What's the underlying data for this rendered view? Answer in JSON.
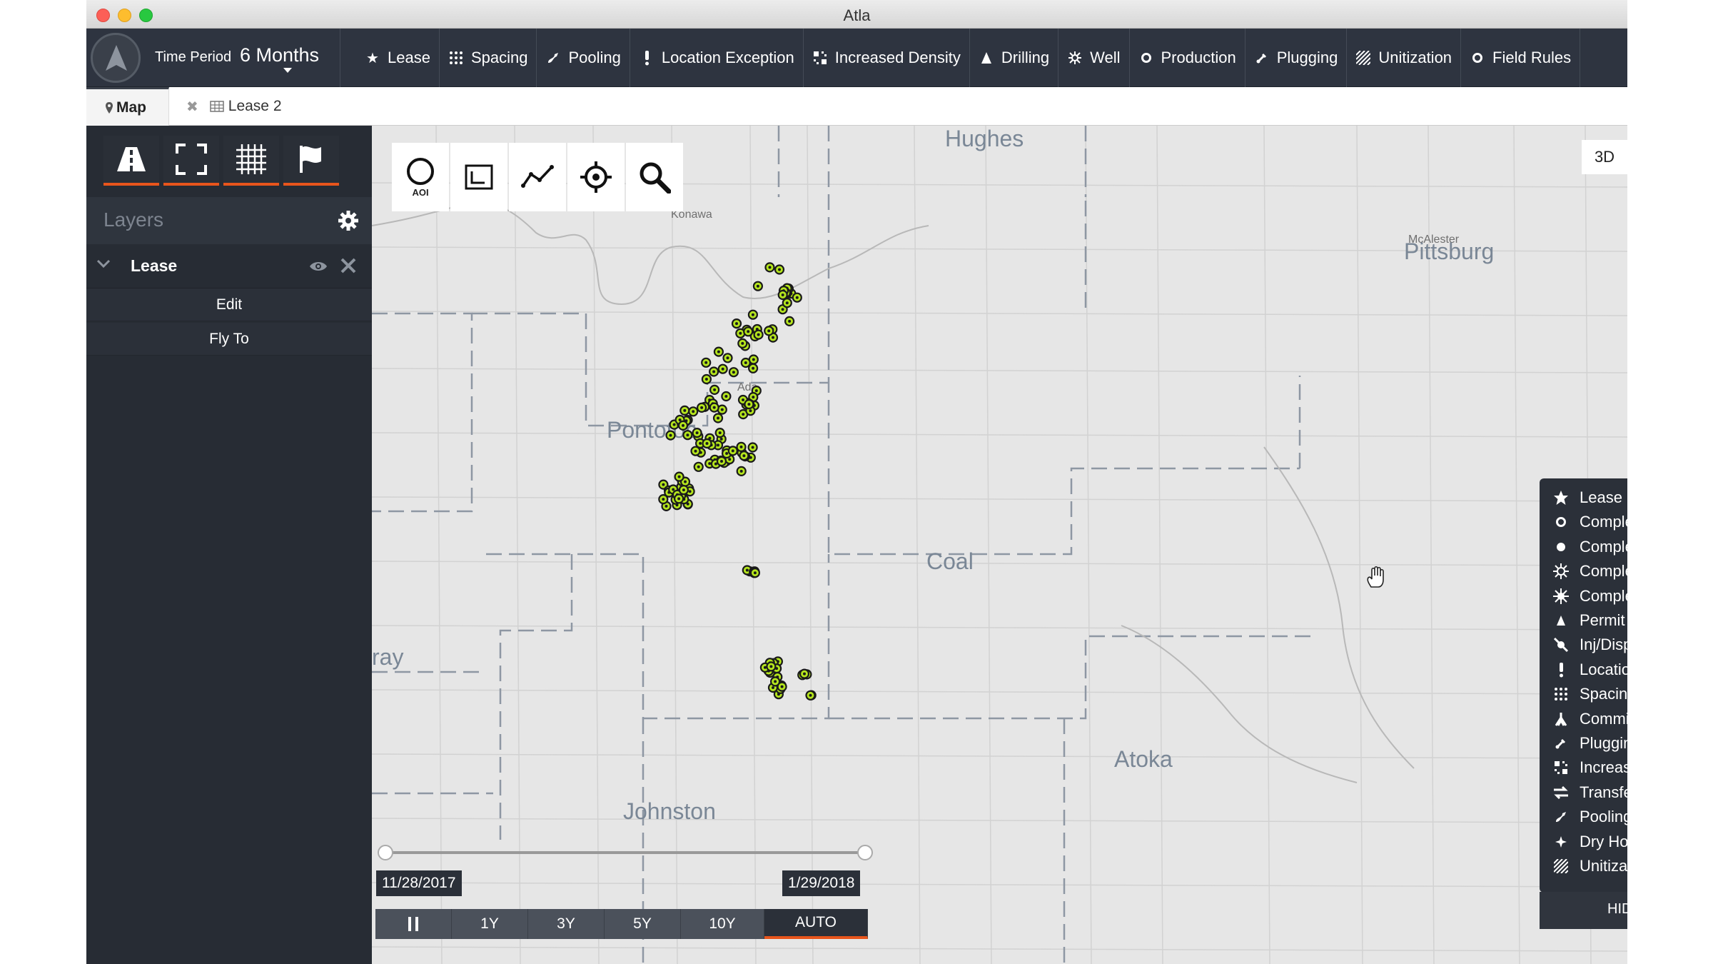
{
  "window": {
    "title": "Atla"
  },
  "topbar": {
    "time_period_label": "Time Period",
    "time_period_value": "6 Months",
    "nav": [
      {
        "label": "Lease",
        "icon": "star-icon"
      },
      {
        "label": "Spacing",
        "icon": "grid-dots-icon"
      },
      {
        "label": "Pooling",
        "icon": "pooling-icon"
      },
      {
        "label": "Location Exception",
        "icon": "exclamation-icon"
      },
      {
        "label": "Increased Density",
        "icon": "density-icon"
      },
      {
        "label": "Drilling",
        "icon": "drill-icon"
      },
      {
        "label": "Well",
        "icon": "well-icon"
      },
      {
        "label": "Production",
        "icon": "circle-icon"
      },
      {
        "label": "Plugging",
        "icon": "plug-icon"
      },
      {
        "label": "Unitization",
        "icon": "hatch-icon"
      },
      {
        "label": "Field Rules",
        "icon": "circle-icon"
      }
    ]
  },
  "tabs": {
    "map": "Map",
    "lease": "Lease 2"
  },
  "sidebar": {
    "layers_title": "Layers",
    "layer_name": "Lease",
    "actions": [
      "Edit",
      "Fly To"
    ]
  },
  "map": {
    "aoi_label": "AOI",
    "btn_3d": "3D",
    "labels": {
      "counties": [
        "Hughes",
        "Pittsburg",
        "Pontotoc",
        "Coal",
        "Atoka",
        "Johnston",
        "ray"
      ],
      "towns": [
        "Konawa",
        "McAlester",
        "Ada"
      ]
    },
    "timeline": {
      "start_date": "11/28/2017",
      "end_date": "1/29/2018",
      "buttons": [
        "1Y",
        "3Y",
        "5Y",
        "10Y",
        "AUTO"
      ],
      "active_button": "AUTO"
    }
  },
  "legend": {
    "items": [
      {
        "label": "Lease",
        "icon": "star-icon"
      },
      {
        "label": "Completion",
        "icon": "ring-icon"
      },
      {
        "label": "Completion (Oil)",
        "icon": "dot-icon"
      },
      {
        "label": "Completion (Gas)",
        "icon": "sun-icon"
      },
      {
        "label": "Completion (Oil &",
        "icon": "sun-dot-icon"
      },
      {
        "label": "Permit",
        "icon": "triangle-icon"
      },
      {
        "label": "Inj/Disp Well",
        "icon": "slash-well-icon"
      },
      {
        "label": "Location Exceptio",
        "icon": "exclamation-icon"
      },
      {
        "label": "Spacing",
        "icon": "grid-dots-icon"
      },
      {
        "label": "Commingle",
        "icon": "commingle-icon"
      },
      {
        "label": "Plugging",
        "icon": "plug-icon"
      },
      {
        "label": "Increased Density",
        "icon": "density-icon"
      },
      {
        "label": "Transfer",
        "icon": "transfer-icon"
      },
      {
        "label": "Pooling",
        "icon": "pooling-icon"
      },
      {
        "label": "Dry Hole",
        "icon": "dry-hole-icon"
      },
      {
        "label": "Unitization",
        "icon": "hatch-icon"
      }
    ],
    "hide_label": "HIDE LEGEND"
  },
  "colors": {
    "accent": "#e8551c",
    "well_marker": "#b5e61d",
    "topbar_bg": "#2e3440",
    "map_bg": "#e6e6e6"
  }
}
